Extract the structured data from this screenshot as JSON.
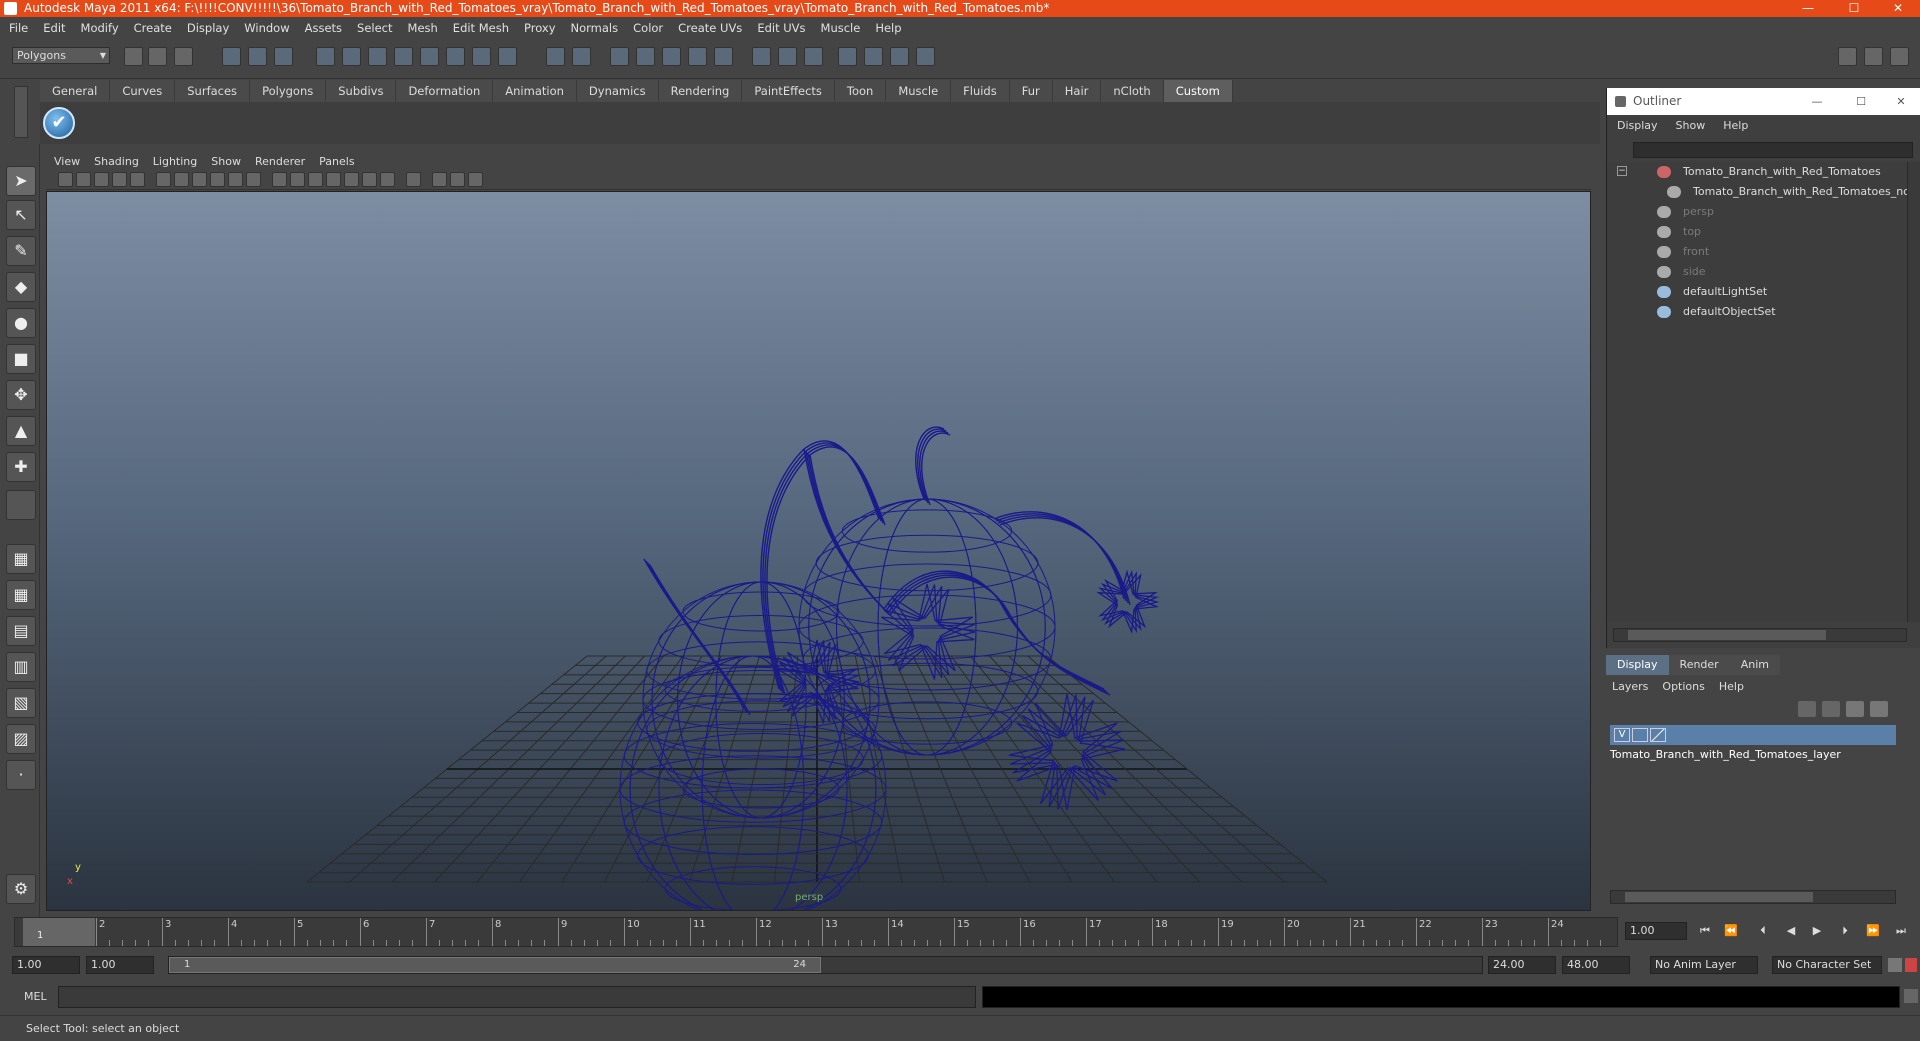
{
  "window": {
    "title": "Autodesk Maya 2011 x64: F:\\!!!!CONV!!!!!\\36\\Tomato_Branch_with_Red_Tomatoes_vray\\Tomato_Branch_with_Red_Tomatoes_vray\\Tomato_Branch_with_Red_Tomatoes.mb*",
    "minimize": "—",
    "maximize": "☐",
    "close": "✕"
  },
  "menubar": [
    "File",
    "Edit",
    "Modify",
    "Create",
    "Display",
    "Window",
    "Assets",
    "Select",
    "Mesh",
    "Edit Mesh",
    "Proxy",
    "Normals",
    "Color",
    "Create UVs",
    "Edit UVs",
    "Muscle",
    "Help"
  ],
  "status": {
    "mode": "Polygons"
  },
  "shelf": {
    "tabs": [
      "General",
      "Curves",
      "Surfaces",
      "Polygons",
      "Subdivs",
      "Deformation",
      "Animation",
      "Dynamics",
      "Rendering",
      "PaintEffects",
      "Toon",
      "Muscle",
      "Fluids",
      "Fur",
      "Hair",
      "nCloth",
      "Custom"
    ],
    "active": "Custom"
  },
  "viewport": {
    "menu": [
      "View",
      "Shading",
      "Lighting",
      "Show",
      "Renderer",
      "Panels"
    ],
    "camera_label": "persp",
    "axis_y": "y",
    "axis_x": "x"
  },
  "outliner": {
    "title": "Outliner",
    "menu": [
      "Display",
      "Show",
      "Help"
    ],
    "items": [
      {
        "label": "Tomato_Branch_with_Red_Tomatoes",
        "dim": false
      },
      {
        "label": "Tomato_Branch_with_Red_Tomatoes_nc",
        "dim": false
      },
      {
        "label": "persp",
        "dim": true
      },
      {
        "label": "top",
        "dim": true
      },
      {
        "label": "front",
        "dim": true
      },
      {
        "label": "side",
        "dim": true
      },
      {
        "label": "defaultLightSet",
        "dim": false
      },
      {
        "label": "defaultObjectSet",
        "dim": false
      }
    ]
  },
  "layers": {
    "tabs": [
      "Display",
      "Render",
      "Anim"
    ],
    "active": "Display",
    "menu": [
      "Layers",
      "Options",
      "Help"
    ],
    "row": {
      "visible": "V",
      "name": "Tomato_Branch_with_Red_Tomatoes_layer"
    }
  },
  "timeline": {
    "ticks": [
      "1",
      "2",
      "3",
      "4",
      "5",
      "6",
      "7",
      "8",
      "9",
      "10",
      "11",
      "12",
      "13",
      "14",
      "15",
      "16",
      "17",
      "18",
      "19",
      "20",
      "21",
      "22",
      "23",
      "24"
    ],
    "current_frame": "1.00",
    "current_marker": "1"
  },
  "range": {
    "start": "1.00",
    "playback_start": "1.00",
    "handle_start": "1",
    "handle_end": "24",
    "playback_end": "24.00",
    "end": "48.00",
    "anim_layer": "No Anim Layer",
    "character_set": "No Character Set"
  },
  "command": {
    "label": "MEL"
  },
  "helpline": "Select Tool: select an object",
  "colors": {
    "accent": "#e64a19",
    "wire": "#1a1a8a",
    "layer": "#5a7fa8"
  }
}
